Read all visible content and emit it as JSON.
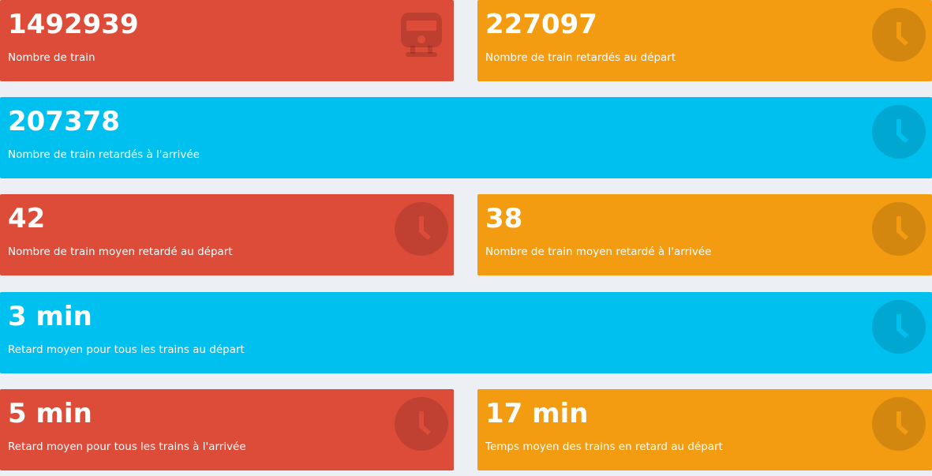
{
  "boxes": [
    {
      "value": "1492939",
      "label": "Nombre de train",
      "color": "#dd4b39",
      "icon": "train-icon"
    },
    {
      "value": "227097",
      "label": "Nombre de train retardés au départ",
      "color": "#f39c12",
      "icon": "clock-icon"
    },
    {
      "value": "207378",
      "label": "Nombre de train retardés à l'arrivée",
      "color": "#00c0ef",
      "icon": "clock-icon"
    },
    {
      "value": "42",
      "label": "Nombre de train moyen retardé au départ",
      "color": "#dd4b39",
      "icon": "clock-icon"
    },
    {
      "value": "38",
      "label": "Nombre de train moyen retardé à l'arrivée",
      "color": "#f39c12",
      "icon": "clock-icon"
    },
    {
      "value": "3 min",
      "label": "Retard moyen pour tous les trains au départ",
      "color": "#00c0ef",
      "icon": "clock-icon"
    },
    {
      "value": "5 min",
      "label": "Retard moyen pour tous les trains à l'arrivée",
      "color": "#dd4b39",
      "icon": "clock-icon"
    },
    {
      "value": "17 min",
      "label": "Temps moyen des trains en retard au départ",
      "color": "#f39c12",
      "icon": "clock-icon"
    }
  ]
}
